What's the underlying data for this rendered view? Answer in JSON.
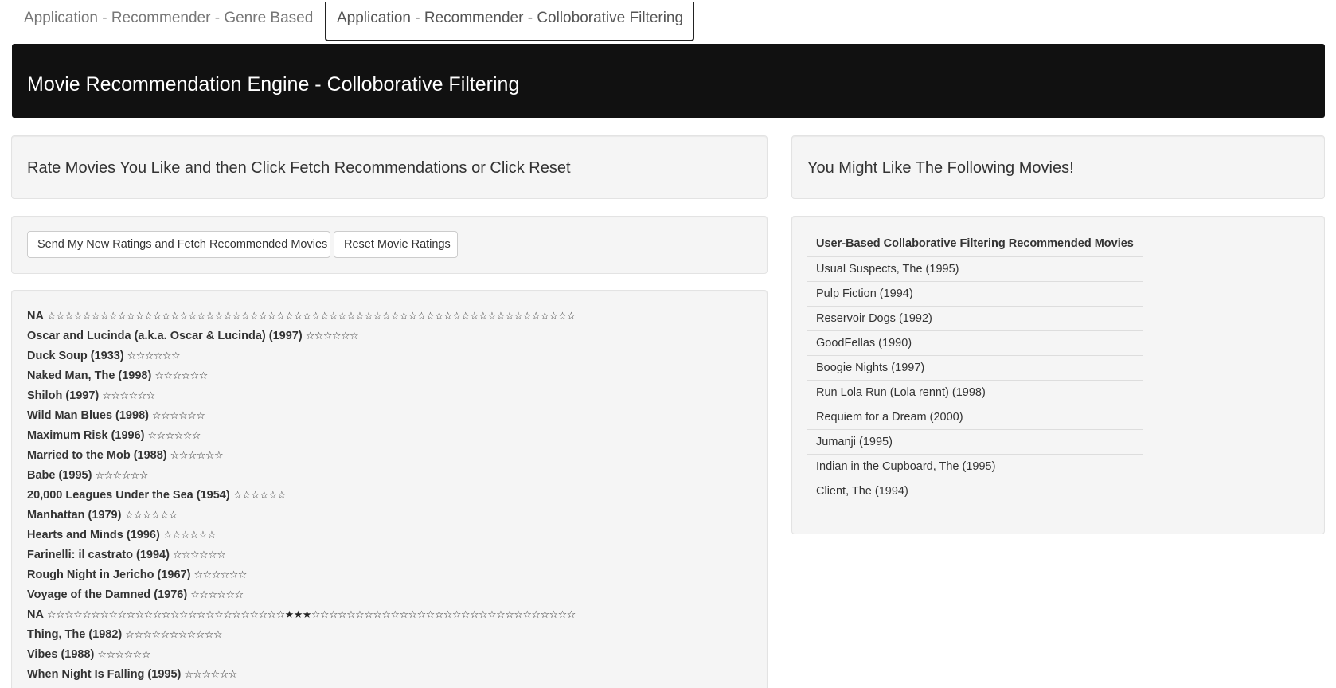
{
  "tabs": [
    {
      "label": "Application - Recommender - Genre Based",
      "active": false
    },
    {
      "label": "Application - Recommender - Colloborative Filtering",
      "active": true
    }
  ],
  "banner": {
    "title": "Movie Recommendation Engine - Colloborative Filtering"
  },
  "instructions": {
    "heading": "Rate Movies You Like and then Click Fetch Recommendations or Click Reset"
  },
  "buttons": {
    "fetch_label": "Send My New Ratings and Fetch Recommended Movies",
    "reset_label": "Reset Movie Ratings"
  },
  "rating_list": [
    {
      "title": "NA",
      "stars": 60,
      "filled": []
    },
    {
      "title": "Oscar and Lucinda (a.k.a. Oscar & Lucinda) (1997)",
      "stars": 6,
      "filled": []
    },
    {
      "title": "Duck Soup (1933)",
      "stars": 6,
      "filled": []
    },
    {
      "title": "Naked Man, The (1998)",
      "stars": 6,
      "filled": []
    },
    {
      "title": "Shiloh (1997)",
      "stars": 6,
      "filled": []
    },
    {
      "title": "Wild Man Blues (1998)",
      "stars": 6,
      "filled": []
    },
    {
      "title": "Maximum Risk (1996)",
      "stars": 6,
      "filled": []
    },
    {
      "title": "Married to the Mob (1988)",
      "stars": 6,
      "filled": []
    },
    {
      "title": "Babe (1995)",
      "stars": 6,
      "filled": []
    },
    {
      "title": "20,000 Leagues Under the Sea (1954)",
      "stars": 6,
      "filled": []
    },
    {
      "title": "Manhattan (1979)",
      "stars": 6,
      "filled": []
    },
    {
      "title": "Hearts and Minds (1996)",
      "stars": 6,
      "filled": []
    },
    {
      "title": "Farinelli: il castrato (1994)",
      "stars": 6,
      "filled": []
    },
    {
      "title": "Rough Night in Jericho (1967)",
      "stars": 6,
      "filled": []
    },
    {
      "title": "Voyage of the Damned (1976)",
      "stars": 6,
      "filled": []
    },
    {
      "title": "NA",
      "stars": 60,
      "filled": [
        27,
        28,
        29
      ]
    },
    {
      "title": "Thing, The (1982)",
      "stars": 11,
      "filled": []
    },
    {
      "title": "Vibes (1988)",
      "stars": 6,
      "filled": []
    },
    {
      "title": "When Night Is Falling (1995)",
      "stars": 6,
      "filled": []
    }
  ],
  "might_like": {
    "heading": "You Might Like The Following Movies!"
  },
  "recommendations": {
    "header": "User-Based Collaborative Filtering Recommended Movies",
    "movies": [
      "Usual Suspects, The (1995)",
      "Pulp Fiction (1994)",
      "Reservoir Dogs (1992)",
      "GoodFellas (1990)",
      "Boogie Nights (1997)",
      "Run Lola Run (Lola rennt) (1998)",
      "Requiem for a Dream (2000)",
      "Jumanji (1995)",
      "Indian in the Cupboard, The (1995)",
      "Client, The (1994)"
    ]
  },
  "icons": {
    "star_empty": "star-outline-icon",
    "star_filled": "star-filled-icon"
  }
}
